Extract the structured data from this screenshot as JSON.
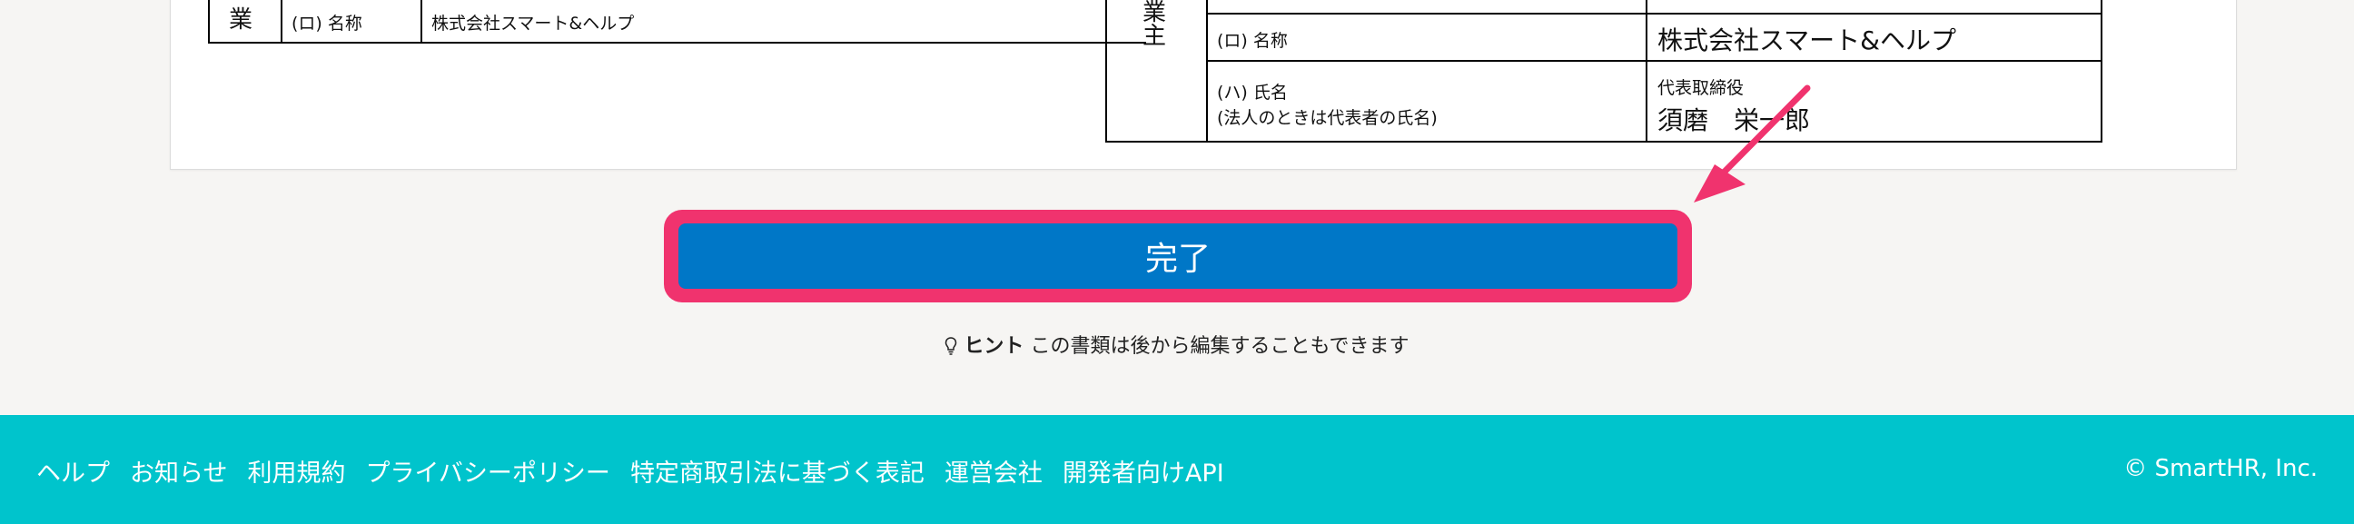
{
  "left_table": {
    "side_char": "業",
    "row_label": "(ロ) 名称",
    "row_value": "株式会社スマート&ヘルプ"
  },
  "right_table": {
    "side_char_top": "業",
    "side_char_bottom": "主",
    "name_label": "(ロ) 名称",
    "name_value": "株式会社スマート&ヘルプ",
    "person_label_1": "(ハ) 氏名",
    "person_label_2": "(法人のときは代表者の氏名)",
    "person_title": "代表取締役",
    "person_name": "須磨　栄一郎"
  },
  "submit": {
    "label": "完了"
  },
  "hint": {
    "icon": "lightbulb-icon",
    "bold_label": "ヒント",
    "text": "この書類は後から編集することもできます"
  },
  "footer": {
    "links": [
      "ヘルプ",
      "お知らせ",
      "利用規約",
      "プライバシーポリシー",
      "特定商取引法に基づく表記",
      "運営会社",
      "開発者向けAPI"
    ],
    "copyright": "© SmartHR, Inc."
  },
  "colors": {
    "primary": "#0077c7",
    "highlight": "#f0336e",
    "footer_bg": "#00c4cc",
    "page_bg": "#f6f5f3"
  }
}
